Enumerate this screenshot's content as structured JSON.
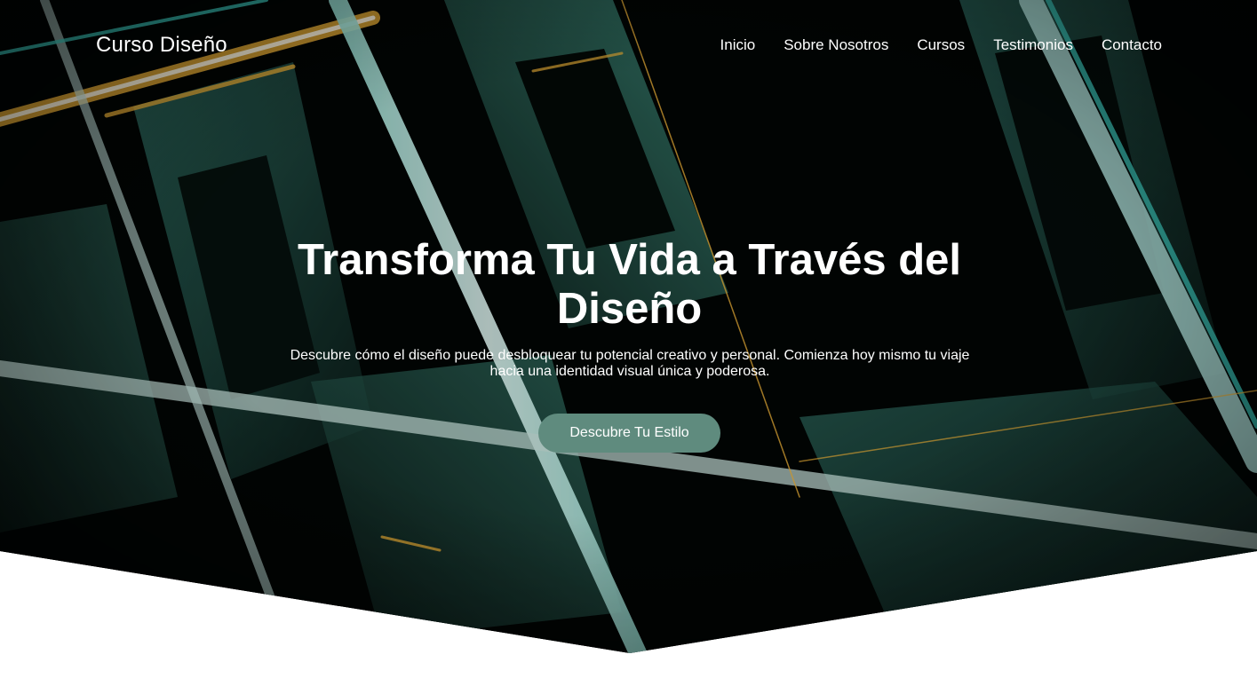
{
  "header": {
    "brand": "Curso Diseño",
    "nav": [
      "Inicio",
      "Sobre Nosotros",
      "Cursos",
      "Testimonios",
      "Contacto"
    ]
  },
  "hero": {
    "title": "Transforma Tu Vida a Través del Diseño",
    "subtitle": "Descubre cómo el diseño puede desbloquear tu potencial creativo y personal. Comienza hoy mismo tu viaje hacia una identidad visual única y poderosa.",
    "cta_label": "Descubre Tu Estilo"
  },
  "colors": {
    "accent": "#5f8b7e",
    "hero_dark": "#020504",
    "glow_teal": "#3fd3c6",
    "glow_gold": "#f5b73a"
  }
}
